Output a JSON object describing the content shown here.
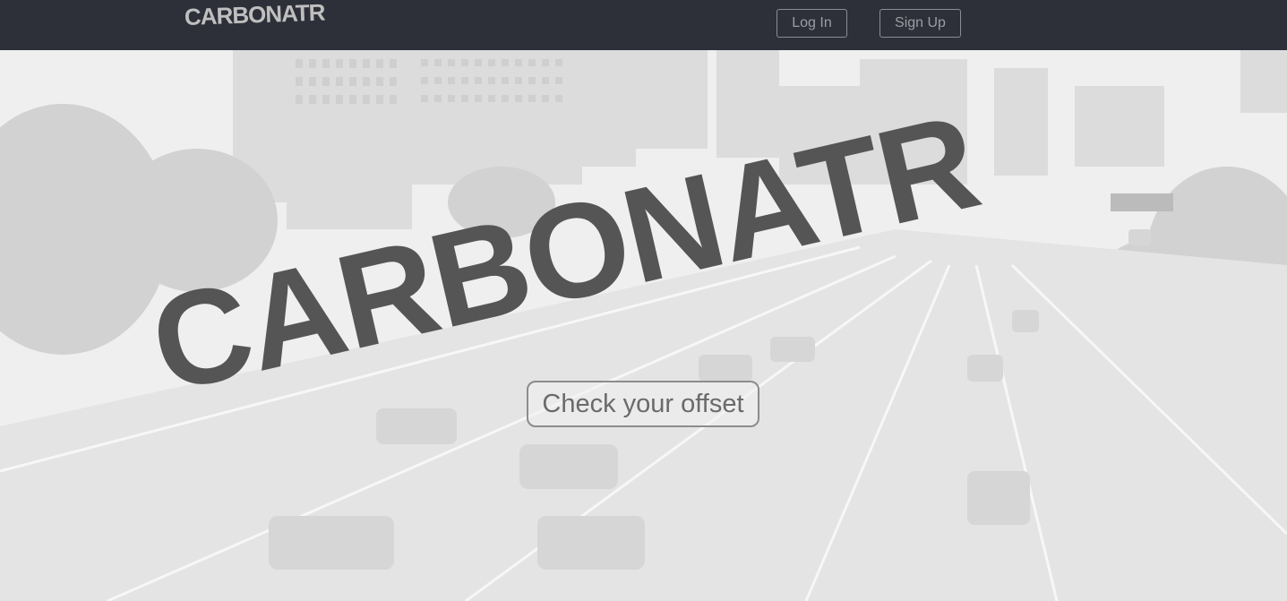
{
  "navbar": {
    "brand": "CARBONATR",
    "login_label": "Log In",
    "signup_label": "Sign Up"
  },
  "hero": {
    "title": "CARBONATR",
    "cta_label": "Check your offset",
    "background": "city-freeway-photo"
  },
  "colors": {
    "navbar_bg": "#2d3039",
    "title_text": "#555555",
    "nav_text": "#9a9da4"
  }
}
